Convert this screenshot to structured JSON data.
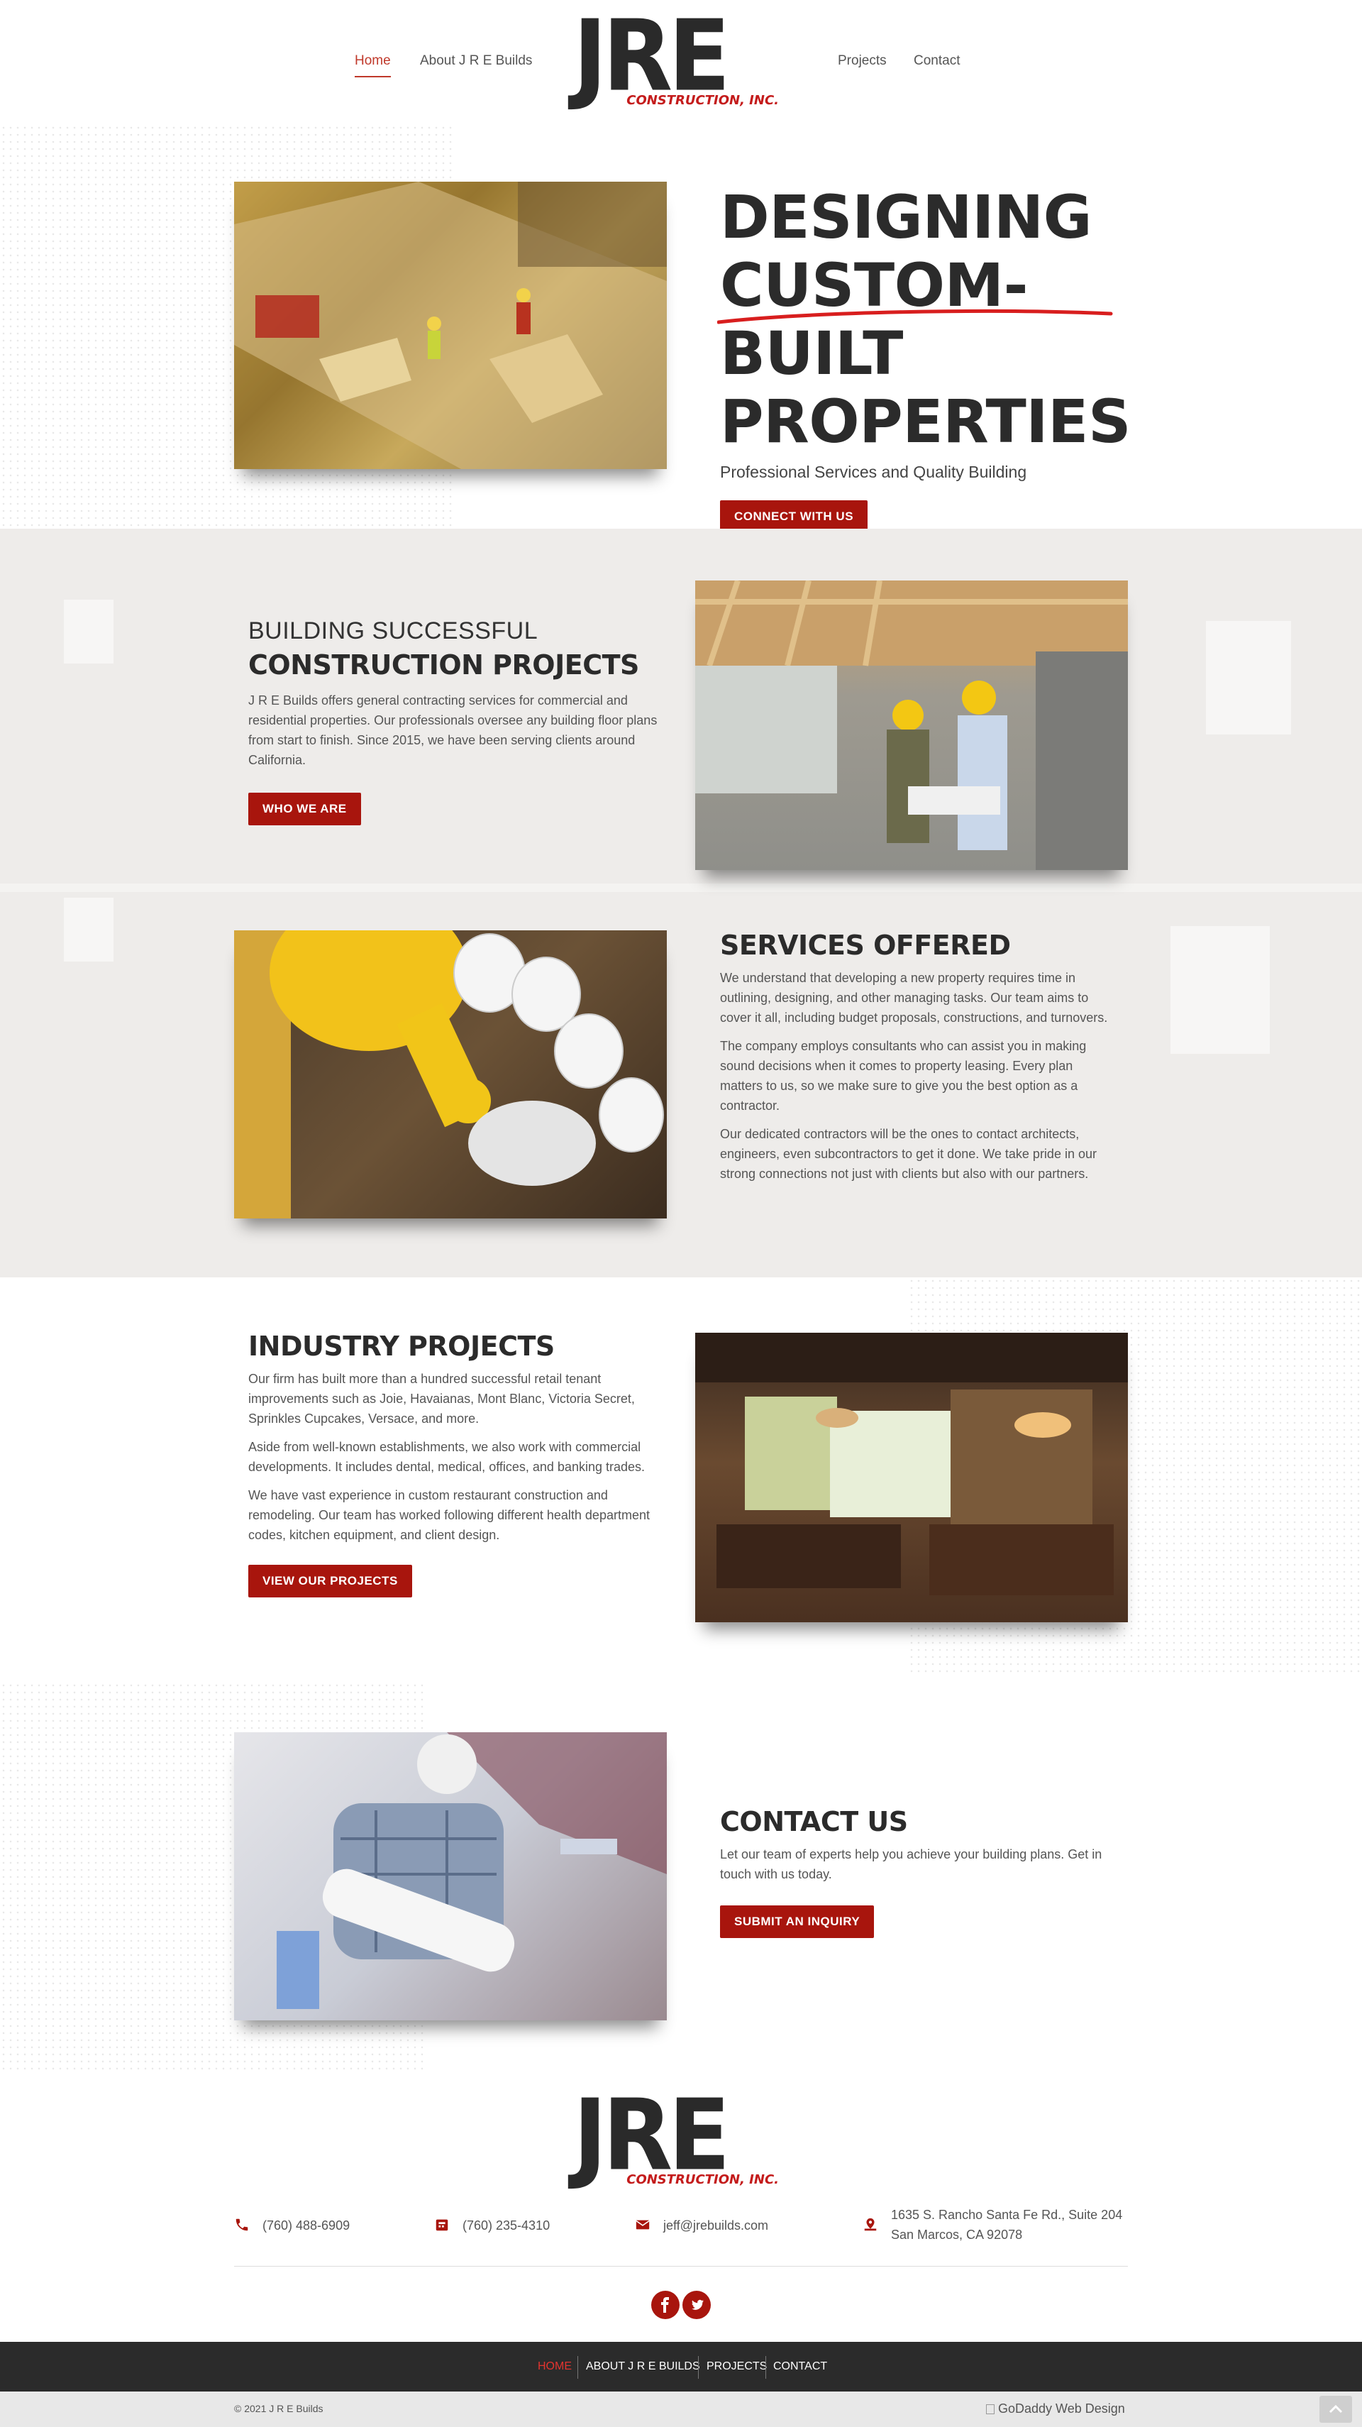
{
  "nav": {
    "items": [
      "Home",
      "About J R E Builds",
      "Projects",
      "Contact"
    ],
    "active": "Home"
  },
  "logo": {
    "letters": "JRE",
    "sub": "CONSTRUCTION, INC."
  },
  "hero": {
    "title_line1": "DESIGNING",
    "title_line2": "CUSTOM-BUILT",
    "title_line3": "PROPERTIES",
    "subtitle": "Professional Services and Quality Building",
    "cta": "CONNECT WITH US"
  },
  "building": {
    "title_light": "BUILDING SUCCESSFUL",
    "title_bold": "CONSTRUCTION PROJECTS",
    "body": "J R E Builds offers general contracting services for commercial and residential properties. Our professionals oversee any building floor plans from start to finish. Since 2015, we have been serving clients around California.",
    "cta": "WHO WE ARE"
  },
  "services": {
    "title": "SERVICES OFFERED",
    "paragraphs": [
      "We understand that developing a new property requires time in outlining, designing, and other managing tasks. Our team aims to cover it all, including budget proposals, constructions, and turnovers.",
      "The company employs consultants who can assist you in making sound decisions when it comes to property leasing. Every plan matters to us, so we make sure to give you the best option as a contractor.",
      "Our dedicated contractors will be the ones to contact architects, engineers, even subcontractors to get it done. We take pride in our strong connections not just with clients but also with our partners."
    ]
  },
  "industry": {
    "title": "INDUSTRY PROJECTS",
    "paragraphs": [
      "Our firm has built more than a hundred successful retail tenant improvements such as Joie, Havaianas, Mont Blanc, Victoria Secret, Sprinkles Cupcakes, Versace, and more.",
      "Aside from well-known establishments, we also work with commercial developments. It includes dental, medical, offices, and banking trades.",
      "We have vast experience in custom restaurant construction and remodeling. Our team has worked following different health department codes, kitchen equipment, and client design."
    ],
    "cta": "VIEW OUR PROJECTS"
  },
  "contact": {
    "title": "CONTACT US",
    "body": "Let our team of experts help you achieve your building plans. Get in touch with us today.",
    "cta": "SUBMIT AN INQUIRY"
  },
  "footer": {
    "phone": "(760) 488-6909",
    "fax": "(760) 235-4310",
    "email": "jeff@jrebuilds.com",
    "address_line1": "1635 S. Rancho Santa Fe Rd., Suite 204",
    "address_line2": "San Marcos, CA 92078",
    "nav": [
      "HOME",
      "ABOUT J R E BUILDS",
      "PROJECTS",
      "CONTACT"
    ],
    "copyright": "© 2021 J R E Builds",
    "credit": "GoDaddy Web Design"
  },
  "colors": {
    "accent": "#a8150d",
    "dark": "#2b2b2b",
    "link_active": "#c0392b"
  },
  "icons": [
    "phone-icon",
    "fax-icon",
    "email-icon",
    "map-marker-icon",
    "facebook-icon",
    "twitter-icon",
    "scroll-top-icon"
  ]
}
